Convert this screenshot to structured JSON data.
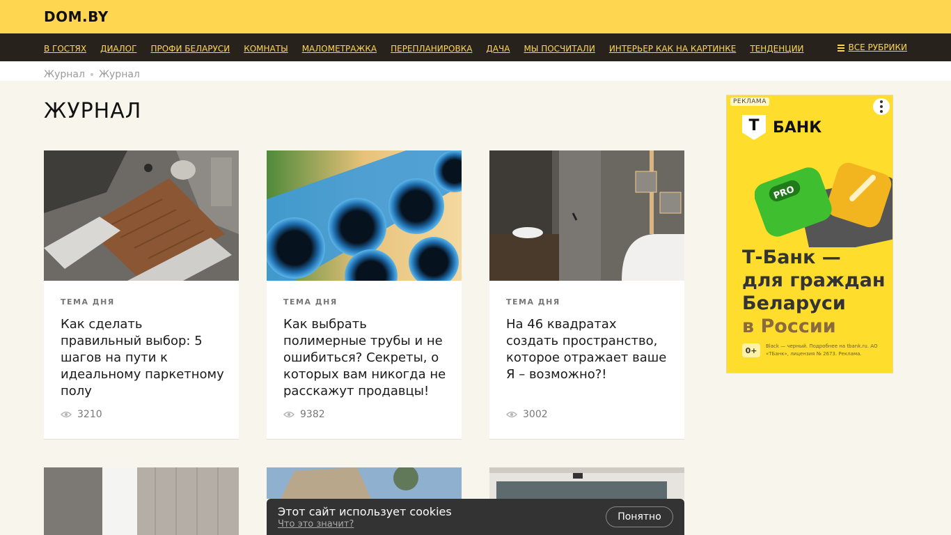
{
  "site": {
    "logo": "DOM.BY"
  },
  "nav": {
    "items": [
      {
        "label": "В ГОСТЯХ"
      },
      {
        "label": "ДИАЛОГ"
      },
      {
        "label": "ПРОФИ БЕЛАРУСИ"
      },
      {
        "label": "КОМНАТЫ"
      },
      {
        "label": "МАЛОМЕТРАЖКА"
      },
      {
        "label": "ПЕРЕПЛАНИРОВКА"
      },
      {
        "label": "ДАЧА"
      },
      {
        "label": "МЫ ПОСЧИТАЛИ"
      },
      {
        "label": "ИНТЕРЬЕР КАК НА КАРТИНКЕ"
      },
      {
        "label": "ТЕНДЕНЦИИ"
      }
    ],
    "all_rubrics": "ВСЕ РУБРИКИ"
  },
  "breadcrumb": [
    "Журнал",
    "Журнал"
  ],
  "page_title": "ЖУРНАЛ",
  "articles": [
    {
      "tag": "ТЕМА ДНЯ",
      "title": "Как сделать правильный выбор: 5 шагов на пути к идеальному паркетному полу",
      "views": "3210"
    },
    {
      "tag": "ТЕМА ДНЯ",
      "title": "Как выбрать полимерные трубы и не ошибиться? Секреты, о которых вам никогда не расскажут продавцы!",
      "views": "9382"
    },
    {
      "tag": "ТЕМА ДНЯ",
      "title": "На 46 квадратах создать пространство, которое отражает ваше Я – возможно?!",
      "views": "3002"
    }
  ],
  "ad": {
    "label": "РЕКЛАМА",
    "brand_letter": "Т",
    "brand": "БАНК",
    "headline": "Т-Банк — для граждан Беларуси",
    "headline_accent": "в России",
    "badge": "PRO",
    "age": "0+",
    "fine_print": "Black — черный. Подробнее на tbank.ru. АО «ТБанк», лицензия № 2673. Реклама."
  },
  "cookie": {
    "text": "Этот сайт использует cookies",
    "link": "Что это значит?",
    "button": "Понятно"
  },
  "colors": {
    "topbar": "#ffd650",
    "navbar": "#27231c",
    "nav_link": "#ffd650",
    "page_bg": "#f8f5ed",
    "ad_bg": "#ffdd2d"
  }
}
